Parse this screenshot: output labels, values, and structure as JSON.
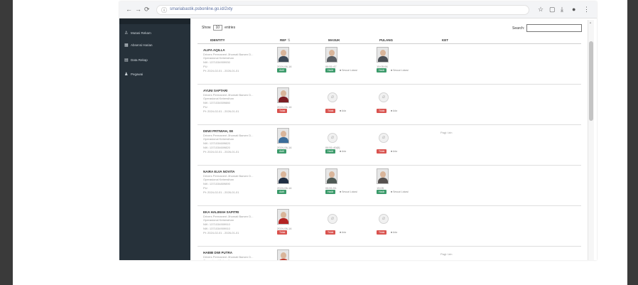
{
  "browser": {
    "url": "smariabastik.psbonline.go.id/2xty",
    "nav": {
      "back": "←",
      "forward": "→",
      "reload": "⟳",
      "page_info": "ⓘ"
    },
    "actions": {
      "star": "☆",
      "tab": "▢",
      "download": "⤓",
      "profile": "●",
      "menu": "⋮"
    }
  },
  "sidebar": {
    "items": [
      {
        "icon": "user-group-icon",
        "glyph": "♙",
        "label": "Mutasi Rekam"
      },
      {
        "icon": "table-icon",
        "glyph": "▦",
        "label": "Absensi Harian"
      },
      {
        "icon": "list-icon",
        "glyph": "▤",
        "label": "Data Rekap"
      },
      {
        "icon": "person-icon",
        "glyph": "♟",
        "label": "Pegawai"
      }
    ]
  },
  "table": {
    "show_label": "Show",
    "show_value": "10",
    "entries_label": "entries",
    "search_label": "Search:",
    "search_value": "",
    "columns": {
      "identity": "IDENTITY",
      "ref": "REF",
      "masuk": "MASUK",
      "pulang": "PULANG",
      "ket": "KET"
    },
    "rows": [
      {
        "name": "ALIFA AQILLA",
        "lines": [
          "Drivers Permanent Jihomati Barsen D...",
          "Operasional Kebersihan",
          "NIK: 1371034909930",
          "PU:",
          "Pt: 2024-02-01 - 2026-01-01"
        ],
        "ref": {
          "date": "2024-06-14",
          "badge": "Aktif",
          "status": "ok",
          "photo": true,
          "tone": "#3d4a58"
        },
        "masuk": {
          "time": "06:51:47",
          "badge": "Hadir",
          "box": "■ Sesuai Lokasi",
          "status": "ok",
          "photo": true,
          "tone": "#5a5e64"
        },
        "pulang": {
          "time": "15:05:06",
          "badge": "Hadir",
          "box": "■ Sesuai Lokasi",
          "status": "ok",
          "photo": true,
          "tone": "#4b4f55"
        },
        "ket": ""
      },
      {
        "name": "AYUNI SAPTARI",
        "lines": [
          "Drivers Permanent Jihomati Barsen D...",
          "Operasional Kebersihan",
          "NIK: 1371034509880",
          "PU:",
          "Pt: 2024-02-01 - 2026-01-01"
        ],
        "ref": {
          "date": "2024-06-14",
          "badge": "Tidak",
          "status": "no",
          "photo": true,
          "tone": "#7b1d23"
        },
        "masuk": {
          "time": "",
          "badge": "Tidak",
          "box": "■ Ada",
          "status": "no",
          "photo": false,
          "tone": ""
        },
        "pulang": {
          "time": "",
          "badge": "Tidak",
          "box": "■ Ada",
          "status": "no",
          "photo": false,
          "tone": ""
        },
        "ket": ""
      },
      {
        "name": "DEWI PRTIWAH, SE",
        "lines": [
          "Drivers Permanent Jihomati Barsen D...",
          "Operasional Kebersihan",
          "NIK: 1371034609820",
          "NIK: 1371034609820",
          "Pt: 2024-02-01 - 2026-01-01"
        ],
        "ref": {
          "date": "2024-06-14",
          "badge": "Aktif",
          "status": "ok",
          "photo": true,
          "tone": "#3b6d9a"
        },
        "masuk": {
          "time": "06:51:49(0)",
          "badge": "Hadir",
          "box": "■ Ada",
          "status": "ok",
          "photo": false,
          "tone": ""
        },
        "pulang": {
          "time": "",
          "badge": "Tidak",
          "box": "■ Ada",
          "status": "no",
          "photo": false,
          "tone": ""
        },
        "ket": "Pagi: Izin"
      },
      {
        "name": "NAIRA ELVA NOVITA",
        "lines": [
          "Drivers Permanent Jihomati Barsen D...",
          "Operasional Kebersihan",
          "NIK: 1371034809890",
          "PU:",
          "Pt: 2024-02-01 - 2026-01-01"
        ],
        "ref": {
          "date": "2024-06-14",
          "badge": "Aktif",
          "status": "ok",
          "photo": true,
          "tone": "#1f2e42"
        },
        "masuk": {
          "time": "06:51:51",
          "badge": "Hadir",
          "box": "■ Sesuai Lokasi",
          "status": "ok",
          "photo": true,
          "tone": "#4f5a55"
        },
        "pulang": {
          "time": "15:05",
          "badge": "Hadir",
          "box": "■ Sesuai Lokasi",
          "status": "ok",
          "photo": true,
          "tone": "#55504e"
        },
        "ket": ""
      },
      {
        "name": "EKA HALIMAH SAPITRI",
        "lines": [
          "Drivers Permanent Jihomati Barsen D...",
          "Operasional Kebersihan",
          "NIK: 1371034909910",
          "NIK: 1371034909910",
          "Pt: 2024-02-01 - 2026-01-01"
        ],
        "ref": {
          "date": "2024-06-14",
          "badge": "Tidak",
          "status": "no",
          "photo": true,
          "tone": "#b22222"
        },
        "masuk": {
          "time": "",
          "badge": "Tidak",
          "box": "■ Ada",
          "status": "no",
          "photo": false,
          "tone": ""
        },
        "pulang": {
          "time": "",
          "badge": "Tidak",
          "box": "■ Ada",
          "status": "no",
          "photo": false,
          "tone": ""
        },
        "ket": ""
      },
      {
        "name": "HABIB DWI PUTRA",
        "lines": [
          "Drivers Permanent Jihomati Barsen D...",
          "Operasional Kebersihan"
        ],
        "ref": {
          "date": "",
          "badge": "",
          "status": "ok",
          "photo": true,
          "tone": "#c0392b"
        },
        "masuk": {
          "time": "",
          "badge": "",
          "box": "",
          "status": "",
          "photo": false,
          "tone": ""
        },
        "pulang": {
          "time": "",
          "badge": "",
          "box": "",
          "status": "",
          "photo": false,
          "tone": ""
        },
        "ket": "Pagi: Izin"
      }
    ]
  },
  "colors": {
    "sidebar": "#26313a",
    "ok": "#3c9b6b",
    "no": "#d9534f",
    "toolbar": "#f3f4f6"
  }
}
